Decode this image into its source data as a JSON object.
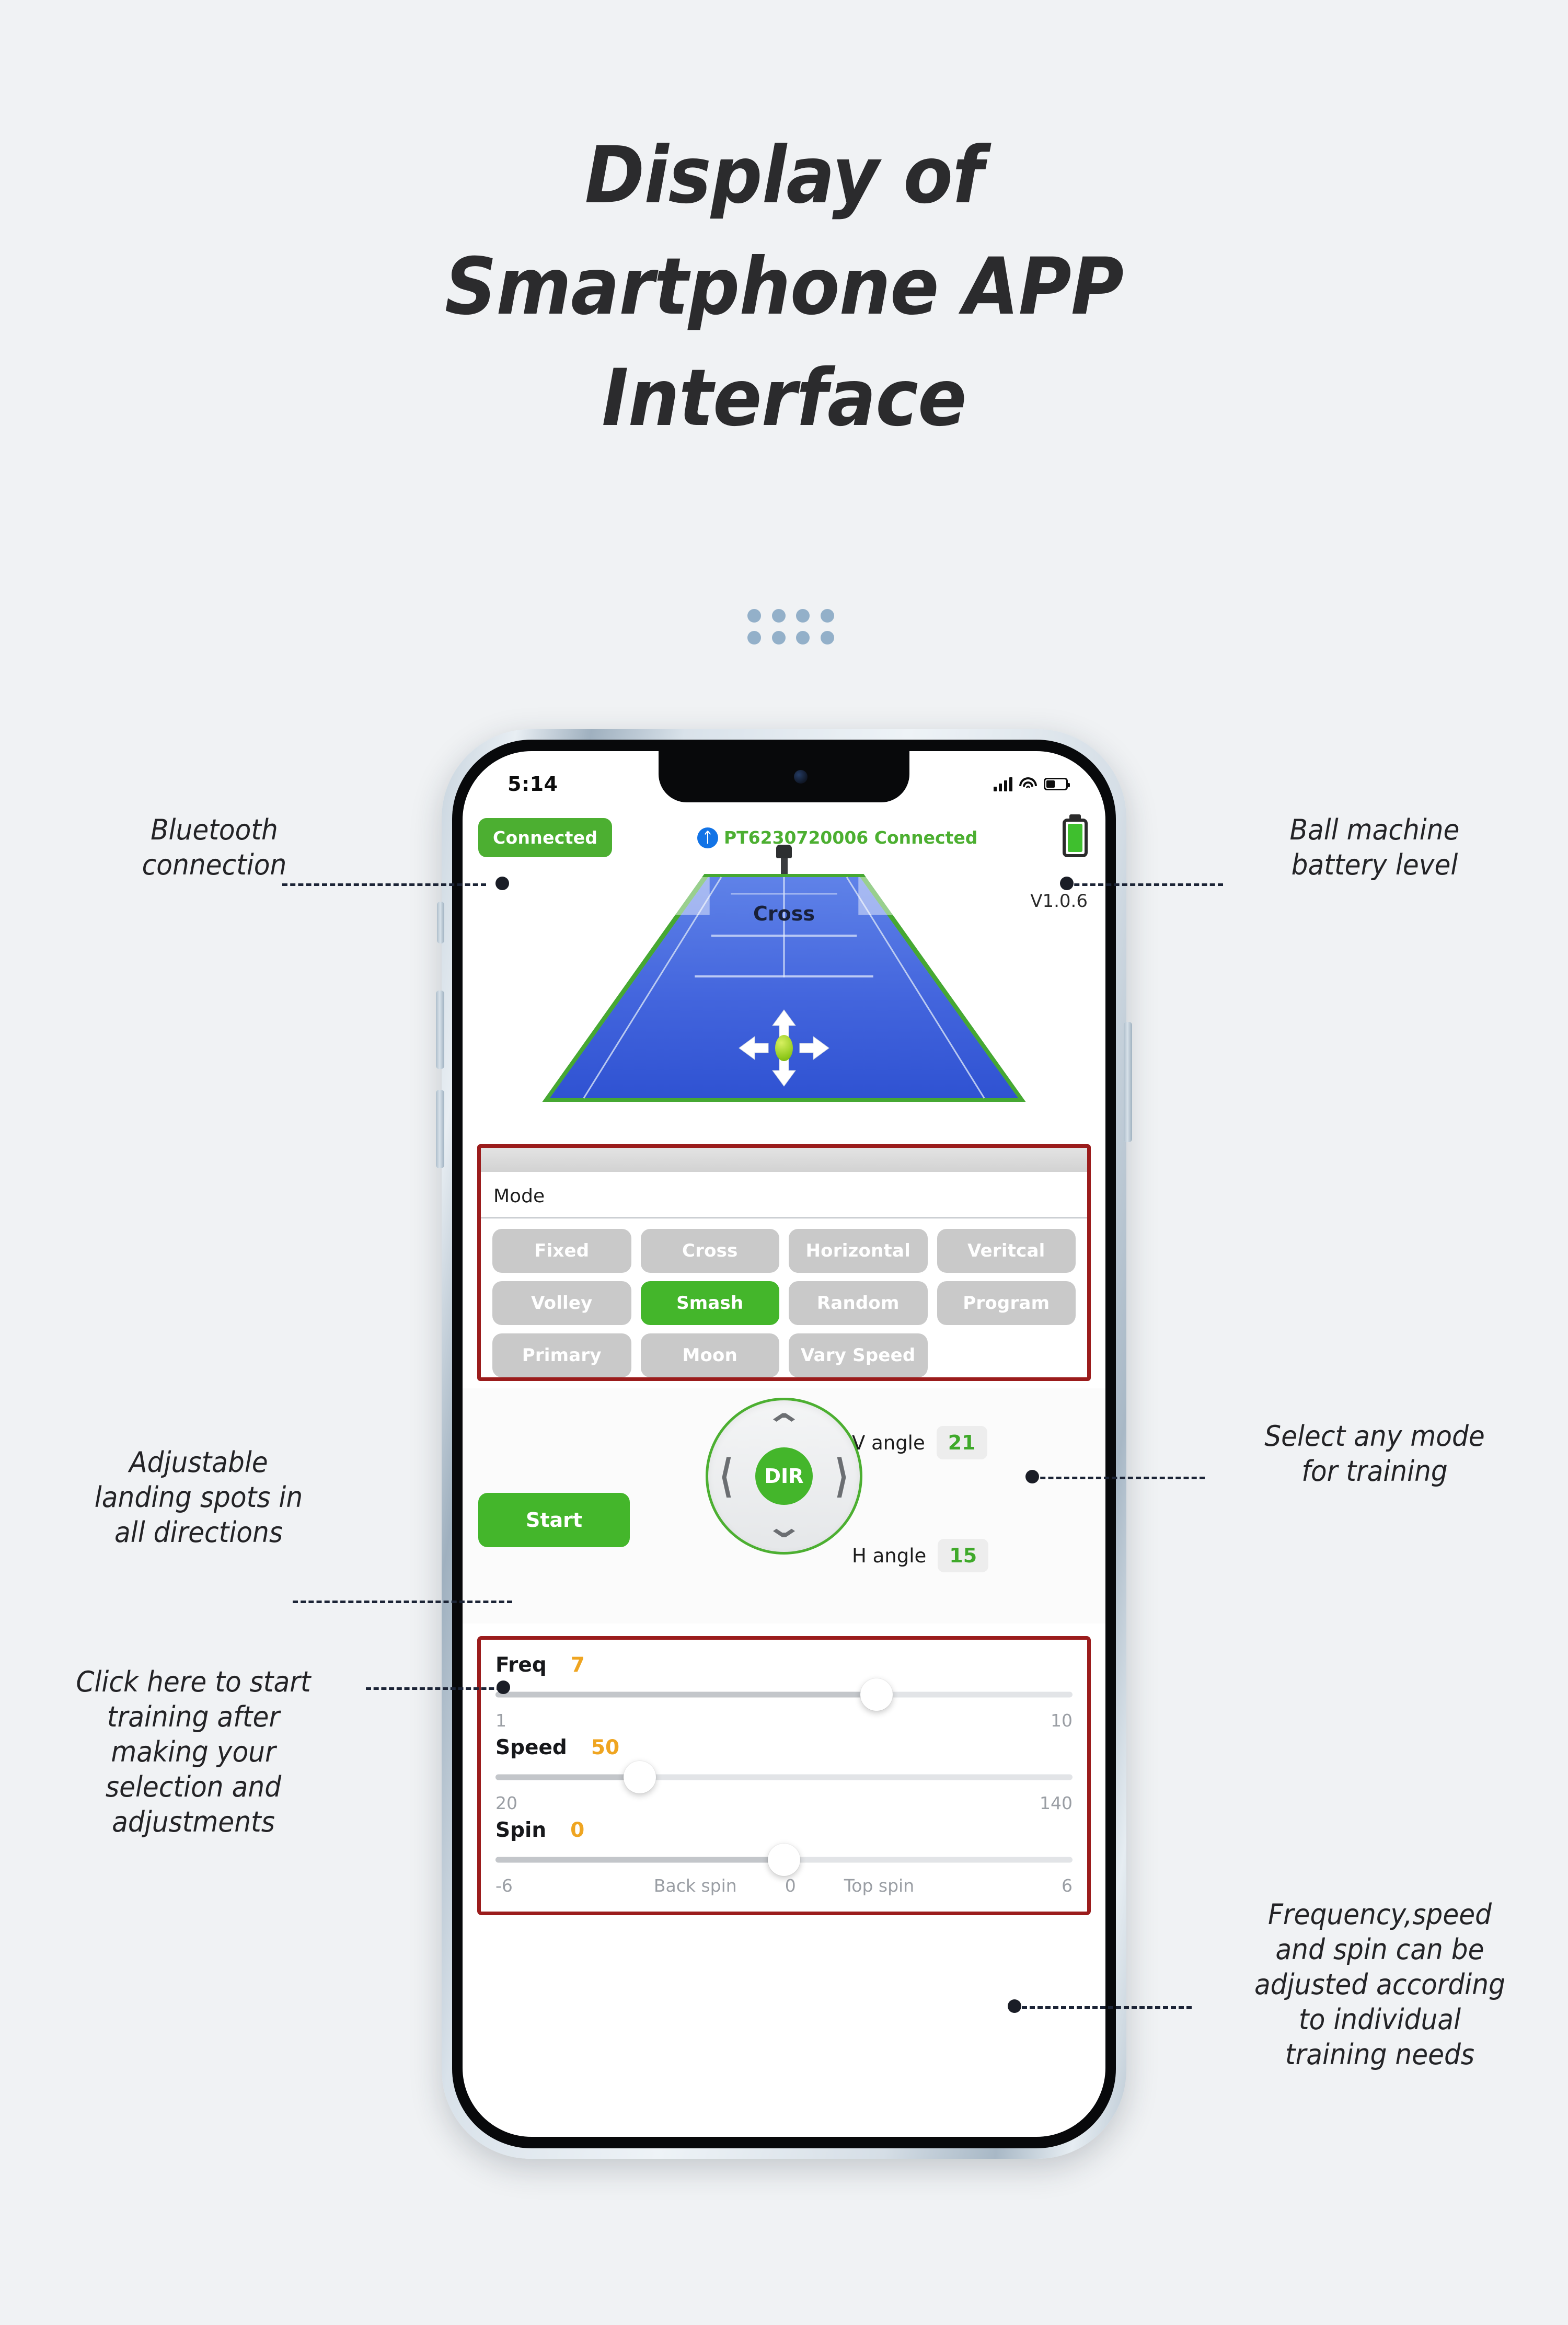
{
  "headline": {
    "line1": "Display of",
    "line2": "Smartphone APP",
    "line3": "Interface"
  },
  "phone": {
    "status_bar": {
      "time": "5:14",
      "signal_icon": "cellular-signal-icon",
      "wifi_icon": "wifi-icon",
      "battery_icon": "battery-icon"
    },
    "app_header": {
      "connected_pill": "Connected",
      "bluetooth_icon": "bluetooth-icon",
      "device_status": "PT6230720006 Connected",
      "machine_battery_icon": "ball-machine-battery-icon"
    },
    "court": {
      "label": "Cross",
      "version": "V1.0.6",
      "dpad_icon": "four-way-arrows-icon",
      "ball_icon": "tennis-ball-icon",
      "machine_icon": "ball-machine-icon"
    },
    "mode_panel": {
      "title": "Mode",
      "buttons": [
        {
          "label": "Fixed",
          "active": false
        },
        {
          "label": "Cross",
          "active": false
        },
        {
          "label": "Horizontal",
          "active": false
        },
        {
          "label": "Veritcal",
          "active": false
        },
        {
          "label": "Volley",
          "active": false
        },
        {
          "label": "Smash",
          "active": true
        },
        {
          "label": "Random",
          "active": false
        },
        {
          "label": "Program",
          "active": false
        },
        {
          "label": "Primary",
          "active": false
        },
        {
          "label": "Moon",
          "active": false
        },
        {
          "label": "Vary Speed",
          "active": false
        }
      ]
    },
    "direction_panel": {
      "start_label": "Start",
      "dir_label": "DIR",
      "up_icon": "chevron-up-icon",
      "down_icon": "chevron-down-icon",
      "left_icon": "chevron-left-icon",
      "right_icon": "chevron-right-icon",
      "v_angle_label": "V angle",
      "v_angle_value": "21",
      "h_angle_label": "H angle",
      "h_angle_value": "15"
    },
    "sliders": [
      {
        "name": "Freq",
        "value": "7",
        "min_label": "1",
        "max_label": "10",
        "percent": 66
      },
      {
        "name": "Speed",
        "value": "50",
        "min_label": "20",
        "max_label": "140",
        "percent": 25
      },
      {
        "name": "Spin",
        "value": "0",
        "min_label": "-6",
        "max_label": "6",
        "mid_left_label": "Back spin",
        "mid_center_label": "0",
        "mid_right_label": "Top spin",
        "percent": 50
      }
    ]
  },
  "annotations": {
    "bluetooth": "Bluetooth\nconnection",
    "battery": "Ball machine\nbattery level",
    "landing": "Adjustable\nlanding spots in\nall directions",
    "mode": "Select any mode\nfor training",
    "start": "Click here to start\ntraining after\nmaking your\nselection and\nadjustments",
    "sliders": "Frequency,speed\nand spin can be\nadjusted according\nto individual\ntraining needs"
  },
  "colors": {
    "background": "#f0f2f4",
    "accent_green": "#44b62b",
    "callout_red": "#9b1c1c",
    "slider_value_orange": "#efa521",
    "court_blue": "#3f62d8",
    "dot_blue": "#93b0c9"
  }
}
